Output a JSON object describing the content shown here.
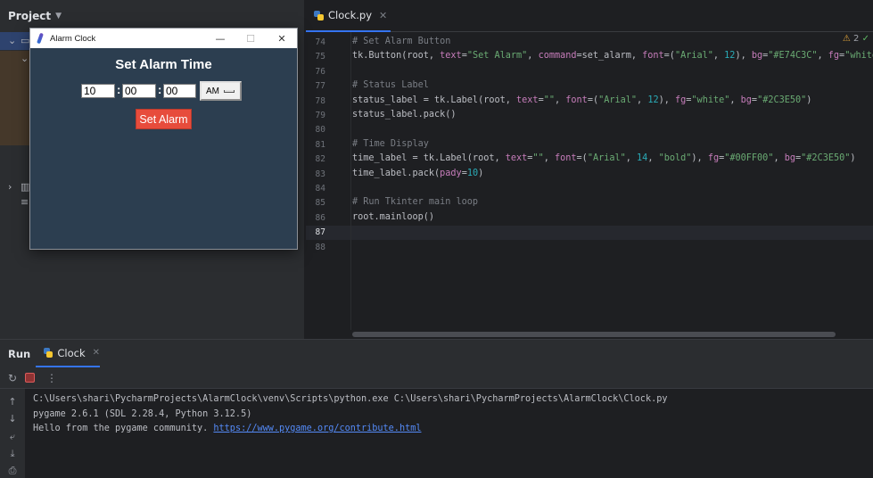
{
  "project_panel": {
    "title": "Project"
  },
  "editor": {
    "tab": {
      "label": "Clock.py"
    },
    "inspection": {
      "count": "2"
    },
    "lines": [
      {
        "num": "74",
        "tokens": [
          {
            "t": "# Set Alarm Button",
            "c": "c-com"
          }
        ]
      },
      {
        "num": "75",
        "tokens": [
          {
            "t": "tk.Button(root, ",
            "c": "c-pl"
          },
          {
            "t": "text",
            "c": "c-kw"
          },
          {
            "t": "=",
            "c": "c-pl"
          },
          {
            "t": "\"Set Alarm\"",
            "c": "c-str"
          },
          {
            "t": ", ",
            "c": "c-pl"
          },
          {
            "t": "command",
            "c": "c-kw"
          },
          {
            "t": "=set_alarm, ",
            "c": "c-pl"
          },
          {
            "t": "font",
            "c": "c-kw"
          },
          {
            "t": "=(",
            "c": "c-pl"
          },
          {
            "t": "\"Arial\"",
            "c": "c-str"
          },
          {
            "t": ", ",
            "c": "c-pl"
          },
          {
            "t": "12",
            "c": "c-num"
          },
          {
            "t": "), ",
            "c": "c-pl"
          },
          {
            "t": "bg",
            "c": "c-kw"
          },
          {
            "t": "=",
            "c": "c-pl"
          },
          {
            "t": "\"#E74C3C\"",
            "c": "c-str"
          },
          {
            "t": ", ",
            "c": "c-pl"
          },
          {
            "t": "fg",
            "c": "c-kw"
          },
          {
            "t": "=",
            "c": "c-pl"
          },
          {
            "t": "\"white\"",
            "c": "c-str"
          },
          {
            "t": ")",
            "c": "c-pl"
          }
        ]
      },
      {
        "num": "76",
        "tokens": []
      },
      {
        "num": "77",
        "tokens": [
          {
            "t": "# Status Label",
            "c": "c-com"
          }
        ]
      },
      {
        "num": "78",
        "tokens": [
          {
            "t": "status_label = tk.Label(root, ",
            "c": "c-pl"
          },
          {
            "t": "text",
            "c": "c-kw"
          },
          {
            "t": "=",
            "c": "c-pl"
          },
          {
            "t": "\"\"",
            "c": "c-str"
          },
          {
            "t": ", ",
            "c": "c-pl"
          },
          {
            "t": "font",
            "c": "c-kw"
          },
          {
            "t": "=(",
            "c": "c-pl"
          },
          {
            "t": "\"Arial\"",
            "c": "c-str"
          },
          {
            "t": ", ",
            "c": "c-pl"
          },
          {
            "t": "12",
            "c": "c-num"
          },
          {
            "t": "), ",
            "c": "c-pl"
          },
          {
            "t": "fg",
            "c": "c-kw"
          },
          {
            "t": "=",
            "c": "c-pl"
          },
          {
            "t": "\"white\"",
            "c": "c-str"
          },
          {
            "t": ", ",
            "c": "c-pl"
          },
          {
            "t": "bg",
            "c": "c-kw"
          },
          {
            "t": "=",
            "c": "c-pl"
          },
          {
            "t": "\"#2C3E50\"",
            "c": "c-str"
          },
          {
            "t": ")",
            "c": "c-pl"
          }
        ]
      },
      {
        "num": "79",
        "tokens": [
          {
            "t": "status_label.pack()",
            "c": "c-pl"
          }
        ]
      },
      {
        "num": "80",
        "tokens": []
      },
      {
        "num": "81",
        "tokens": [
          {
            "t": "# Time Display",
            "c": "c-com"
          }
        ]
      },
      {
        "num": "82",
        "tokens": [
          {
            "t": "time_label = tk.Label(root, ",
            "c": "c-pl"
          },
          {
            "t": "text",
            "c": "c-kw"
          },
          {
            "t": "=",
            "c": "c-pl"
          },
          {
            "t": "\"\"",
            "c": "c-str"
          },
          {
            "t": ", ",
            "c": "c-pl"
          },
          {
            "t": "font",
            "c": "c-kw"
          },
          {
            "t": "=(",
            "c": "c-pl"
          },
          {
            "t": "\"Arial\"",
            "c": "c-str"
          },
          {
            "t": ", ",
            "c": "c-pl"
          },
          {
            "t": "14",
            "c": "c-num"
          },
          {
            "t": ", ",
            "c": "c-pl"
          },
          {
            "t": "\"bold\"",
            "c": "c-str"
          },
          {
            "t": "), ",
            "c": "c-pl"
          },
          {
            "t": "fg",
            "c": "c-kw"
          },
          {
            "t": "=",
            "c": "c-pl"
          },
          {
            "t": "\"#00FF00\"",
            "c": "c-str"
          },
          {
            "t": ", ",
            "c": "c-pl"
          },
          {
            "t": "bg",
            "c": "c-kw"
          },
          {
            "t": "=",
            "c": "c-pl"
          },
          {
            "t": "\"#2C3E50\"",
            "c": "c-str"
          },
          {
            "t": ")",
            "c": "c-pl"
          }
        ]
      },
      {
        "num": "83",
        "tokens": [
          {
            "t": "time_label.pack(",
            "c": "c-pl"
          },
          {
            "t": "pady",
            "c": "c-kw"
          },
          {
            "t": "=",
            "c": "c-pl"
          },
          {
            "t": "10",
            "c": "c-num"
          },
          {
            "t": ")",
            "c": "c-pl"
          }
        ]
      },
      {
        "num": "84",
        "tokens": []
      },
      {
        "num": "85",
        "tokens": [
          {
            "t": "# Run Tkinter main loop",
            "c": "c-com"
          }
        ]
      },
      {
        "num": "86",
        "tokens": [
          {
            "t": "root.mainloop()",
            "c": "c-pl"
          }
        ]
      },
      {
        "num": "87",
        "tokens": []
      },
      {
        "num": "88",
        "tokens": []
      }
    ]
  },
  "alarm_window": {
    "title": "Alarm Clock",
    "heading": "Set Alarm Time",
    "hour": "10",
    "minute": "00",
    "second": "00",
    "colon": ":",
    "ampm": "AM",
    "button_label": "Set Alarm",
    "controls": {
      "minimize": "—",
      "maximize": "☐",
      "close": "✕"
    }
  },
  "run_panel": {
    "title": "Run",
    "tab_label": "Clock",
    "console": [
      {
        "text": "C:\\Users\\shari\\PycharmProjects\\AlarmClock\\venv\\Scripts\\python.exe C:\\Users\\shari\\PycharmProjects\\AlarmClock\\Clock.py",
        "link": ""
      },
      {
        "text": "pygame 2.6.1 (SDL 2.28.4, Python 3.12.5)",
        "link": ""
      },
      {
        "text": "Hello from the pygame community. ",
        "link": "https://www.pygame.org/contribute.html"
      }
    ]
  },
  "colors": {
    "accent": "#3574f0",
    "tk_bg": "#2c3e50",
    "tk_button": "#e74c3c"
  }
}
